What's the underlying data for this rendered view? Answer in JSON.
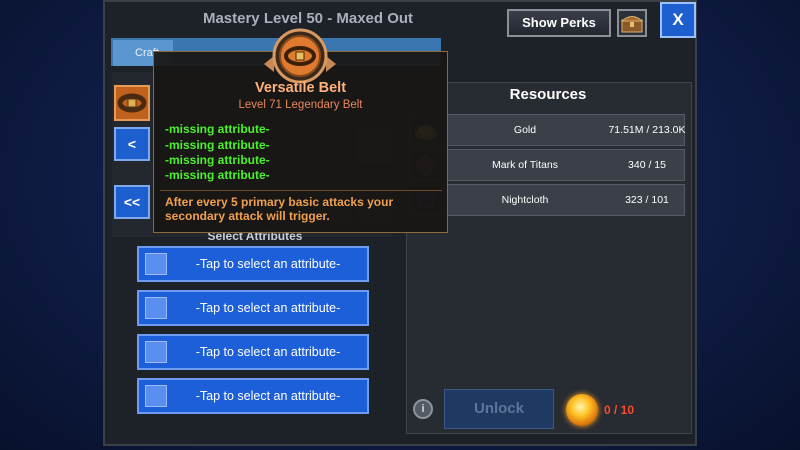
{
  "header": {
    "title": "Mastery Level 50 - Maxed Out",
    "show_perks": "Show Perks",
    "close": "X"
  },
  "tabs": [
    {
      "label": "Craft"
    }
  ],
  "left": {
    "nav_single": "<",
    "nav_double": "<<",
    "select_attributes_label": "Select Attributes",
    "attribute_buttons": [
      "-Tap to select an attribute-",
      "-Tap to select an attribute-",
      "-Tap to select an attribute-",
      "-Tap to select an attribute-"
    ]
  },
  "resources": {
    "title": "Resources",
    "items": [
      {
        "name": "Gold",
        "value": "71.51M / 213.0K",
        "icon": "gold-pile-icon"
      },
      {
        "name": "Mark of Titans",
        "value": "340 / 15",
        "icon": "mark-of-titans-icon"
      },
      {
        "name": "Nightcloth",
        "value": "323 / 101",
        "icon": "nightcloth-icon"
      }
    ]
  },
  "footer": {
    "unlock": "Unlock",
    "orb_count": "0 / 10",
    "info": "i"
  },
  "tooltip": {
    "title": "Versatile Belt",
    "subtitle": "Level 71 Legendary Belt",
    "attributes": [
      "-missing attribute-",
      "-missing attribute-",
      "-missing attribute-",
      "-missing attribute-"
    ],
    "description": "After every 5 primary basic attacks your secondary attack will trigger."
  },
  "colors": {
    "accent_blue": "#1d5fd8",
    "legendary_orange": "#ffb27a",
    "attribute_green": "#4cf02e",
    "warning_red": "#ff4a2f"
  }
}
